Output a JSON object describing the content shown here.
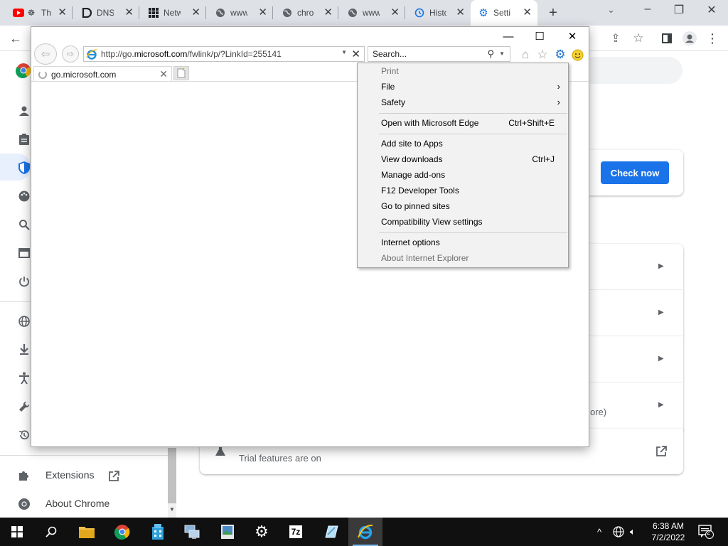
{
  "chrome": {
    "tabs": [
      {
        "title": "Th",
        "icon": "youtube-icon"
      },
      {
        "title": "DNS",
        "icon": "dns-icon"
      },
      {
        "title": "Netw",
        "icon": "grid-icon"
      },
      {
        "title": "www",
        "icon": "globe-icon"
      },
      {
        "title": "chro",
        "icon": "globe-icon"
      },
      {
        "title": "www",
        "icon": "globe-icon"
      },
      {
        "title": "Histo",
        "icon": "history-icon"
      },
      {
        "title": "Setti",
        "icon": "settings-gear-icon"
      }
    ],
    "new_tab_symbol": "+",
    "colors": {
      "tabstrip": "#dee1e6",
      "accent": "#1a73e8"
    }
  },
  "settings": {
    "check_now_label": "Check now",
    "trial_text": "Trial features are on",
    "partial_text": "ore)",
    "sidebar": {
      "extensions_label": "Extensions",
      "about_label": "About Chrome"
    }
  },
  "ie": {
    "address": {
      "prefix": "http://go.",
      "domain": "microsoft.com",
      "suffix": "/fwlink/p/?LinkId=255141"
    },
    "search_placeholder": "Search...",
    "tab_title": "go.microsoft.com",
    "menu": {
      "print": "Print",
      "file": "File",
      "safety": "Safety",
      "open_edge": "Open with Microsoft Edge",
      "open_edge_shortcut": "Ctrl+Shift+E",
      "add_site": "Add site to Apps",
      "view_downloads": "View downloads",
      "view_downloads_shortcut": "Ctrl+J",
      "manage_addons": "Manage add-ons",
      "f12": "F12 Developer Tools",
      "pinned": "Go to pinned sites",
      "compat": "Compatibility View settings",
      "internet_options": "Internet options",
      "about_ie": "About Internet Explorer"
    }
  },
  "taskbar": {
    "time": "6:38 AM",
    "date": "7/2/2022",
    "notification_count": "2",
    "sevenzip_label": "7z"
  }
}
